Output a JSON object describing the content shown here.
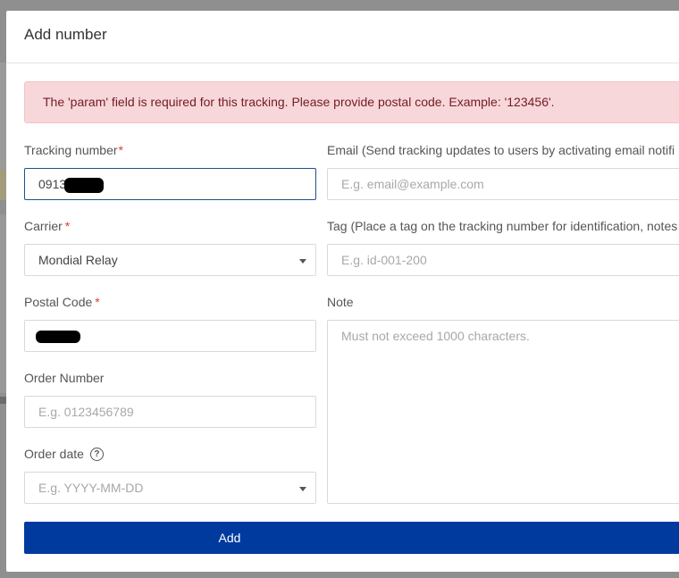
{
  "modal": {
    "title": "Add number",
    "alert": "The 'param' field is required for this tracking. Please provide postal code. Example: '123456'.",
    "submit_label": "Add"
  },
  "fields": {
    "tracking_number": {
      "label": "Tracking number",
      "required_mark": "*",
      "value": "0913"
    },
    "carrier": {
      "label": "Carrier",
      "required_mark": "*",
      "value": "Mondial Relay"
    },
    "postal_code": {
      "label": "Postal Code",
      "required_mark": "*",
      "value": ""
    },
    "order_number": {
      "label": "Order Number",
      "placeholder": "E.g. 0123456789"
    },
    "order_date": {
      "label": "Order date",
      "help_glyph": "?",
      "placeholder": "E.g. YYYY-MM-DD"
    },
    "email": {
      "label": "Email (Send tracking updates to users by activating email notifi",
      "placeholder": "E.g. email@example.com"
    },
    "tag": {
      "label": "Tag (Place a tag on the tracking number for identification, notes",
      "placeholder": "E.g. id-001-200"
    },
    "note": {
      "label": "Note",
      "placeholder": "Must not exceed 1000 characters."
    }
  },
  "icons": {
    "dropdown": "chevron-down-icon",
    "help": "question-circle-icon"
  },
  "colors": {
    "primary_button": "#003a9e",
    "alert_background": "#f8d7da",
    "alert_text": "#721c24",
    "required": "#e53935",
    "focus_border": "#1f4f8f"
  }
}
